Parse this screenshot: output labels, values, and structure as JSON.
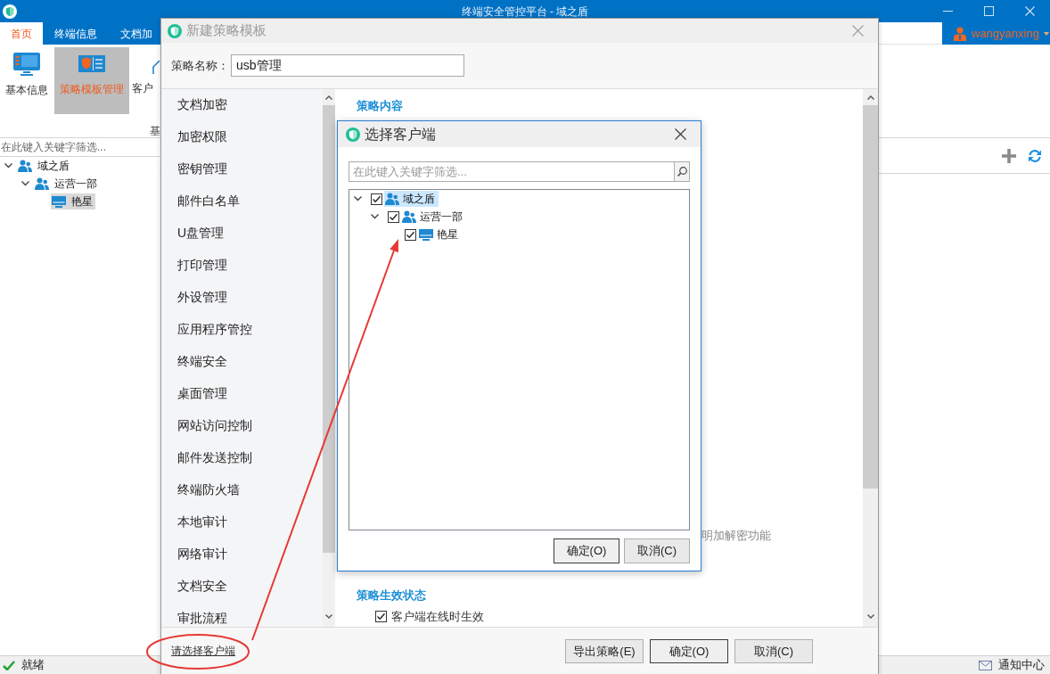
{
  "window": {
    "title": "终端安全管控平台 - 域之盾"
  },
  "menu_tabs": [
    {
      "label": "首页",
      "selected": true
    },
    {
      "label": "终端信息",
      "selected": false
    },
    {
      "label": "文档加",
      "selected": false
    }
  ],
  "user": {
    "name": "wangyanxing"
  },
  "ribbon": {
    "buttons": [
      {
        "label": "基本信息",
        "selected": false
      },
      {
        "label": "策略模板管理",
        "selected": true
      },
      {
        "label": "客户",
        "selected": false
      }
    ],
    "group_label": "基"
  },
  "sidebar": {
    "filter": {
      "placeholder": "在此键入关键字筛选..."
    },
    "tree": [
      {
        "label": "域之盾",
        "kind": "group",
        "expanded": true,
        "selected": false,
        "children": [
          {
            "label": "运营一部",
            "kind": "group",
            "expanded": true,
            "selected": false,
            "children": [
              {
                "label": "艳星",
                "kind": "computer",
                "selected": true
              }
            ]
          }
        ]
      }
    ]
  },
  "status_bar": {
    "status": "就绪",
    "notifications": "通知中心"
  },
  "policy_dialog": {
    "title": "新建策略模板",
    "name_label": "策略名称：",
    "name_value": "usb管理",
    "nav_items": [
      {
        "label": "文档加密",
        "selected": false
      },
      {
        "label": "加密权限",
        "selected": false
      },
      {
        "label": "密钥管理",
        "selected": false
      },
      {
        "label": "邮件白名单",
        "selected": false
      },
      {
        "label": "U盘管理",
        "selected": false
      },
      {
        "label": "打印管理",
        "selected": false
      },
      {
        "label": "外设管理",
        "selected": false
      },
      {
        "label": "应用程序管控",
        "selected": false
      },
      {
        "label": "终端安全",
        "selected": false
      },
      {
        "label": "桌面管理",
        "selected": false
      },
      {
        "label": "网站访问控制",
        "selected": false
      },
      {
        "label": "邮件发送控制",
        "selected": false
      },
      {
        "label": "终端防火墙",
        "selected": false
      },
      {
        "label": "本地审计",
        "selected": false
      },
      {
        "label": "网络审计",
        "selected": false
      },
      {
        "label": "文档安全",
        "selected": false
      },
      {
        "label": "审批流程",
        "selected": false
      }
    ],
    "section_title": "策略内容",
    "description": "明加解密功能",
    "status_section": {
      "title": "策略生效状态",
      "options": [
        {
          "label": "客户端在线时生效",
          "checked": true
        }
      ]
    },
    "client_link": "请选择客户端",
    "buttons": [
      {
        "label": "导出策略(E)",
        "default": false
      },
      {
        "label": "确定(O)",
        "default": true
      },
      {
        "label": "取消(C)",
        "default": false
      }
    ]
  },
  "client_dialog": {
    "title": "选择客户端",
    "search": {
      "placeholder": "在此键入关键字筛选..."
    },
    "tree": [
      {
        "label": "域之盾",
        "kind": "group",
        "expanded": true,
        "checked": true,
        "selected": true,
        "children": [
          {
            "label": "运营一部",
            "kind": "group",
            "expanded": true,
            "checked": true,
            "selected": false,
            "children": [
              {
                "label": "艳星",
                "kind": "computer",
                "checked": true,
                "selected": false
              }
            ]
          }
        ]
      }
    ],
    "buttons": [
      {
        "label": "确定(O)",
        "default": true
      },
      {
        "label": "取消(C)",
        "default": false
      }
    ]
  }
}
